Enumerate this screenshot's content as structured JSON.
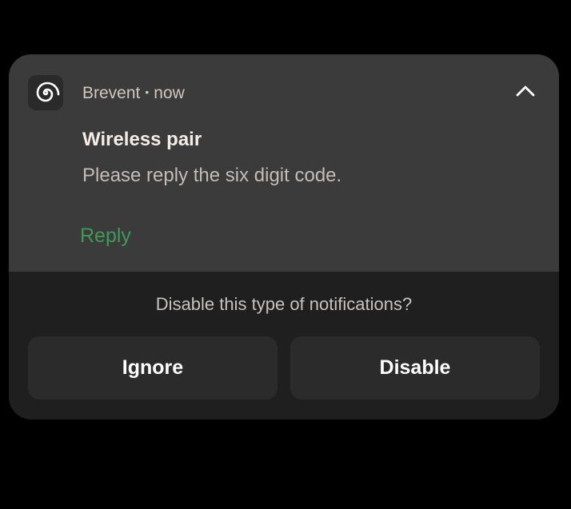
{
  "notification": {
    "app_name": "Brevent",
    "separator": "•",
    "time": "now",
    "title": "Wireless pair",
    "body": "Please reply the six digit code.",
    "reply_label": "Reply",
    "app_icon": "swirl-icon",
    "collapse_icon": "chevron-up-icon"
  },
  "disable_panel": {
    "prompt": "Disable this type of notifications?",
    "ignore_label": "Ignore",
    "disable_label": "Disable"
  },
  "colors": {
    "background": "#000000",
    "card_top": "#3b3b3b",
    "card_bottom": "#1f1f1f",
    "button_bg": "#2b2b2b",
    "reply_accent": "#3d9a57"
  }
}
